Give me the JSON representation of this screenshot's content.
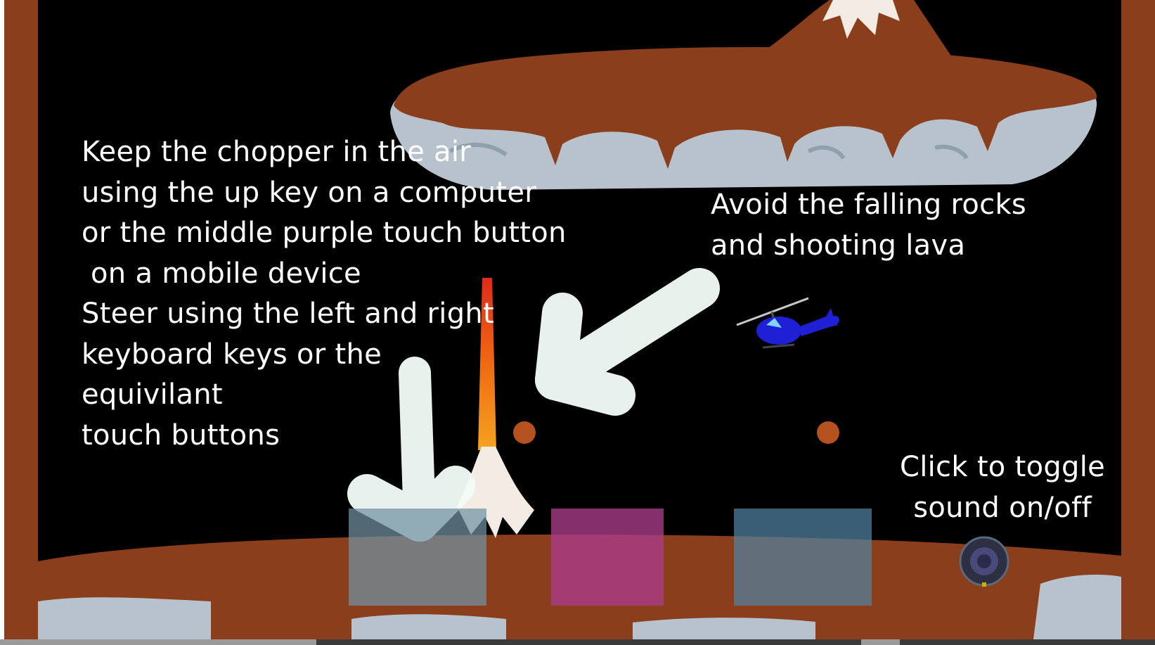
{
  "instructions": {
    "controls_text": "Keep the chopper in the air\nusing the up key on a computer\nor the middle purple touch button\n on a mobile device\nSteer using the left and right\nkeyboard keys or the\nequivilant\ntouch buttons",
    "hazards_text": "Avoid the falling rocks\nand shooting lava",
    "sound_text": "Click to toggle\nsound on/off"
  },
  "touch_buttons": [
    {
      "action": "left",
      "color": "#7092a2"
    },
    {
      "action": "up",
      "color": "#aa3c8c"
    },
    {
      "action": "right",
      "color": "#5082a0"
    }
  ],
  "colors": {
    "background": "#000000",
    "rock_brown": "#8b3e1c",
    "stone_grey": "#b8c2cc",
    "helicopter": "#1f1fd6",
    "lava": "#f06a12",
    "hint_arrow": "#f2fbf7"
  },
  "icons": {
    "sound_toggle": "speaker-icon",
    "player": "helicopter-icon",
    "hazard": "boulder-icon"
  }
}
